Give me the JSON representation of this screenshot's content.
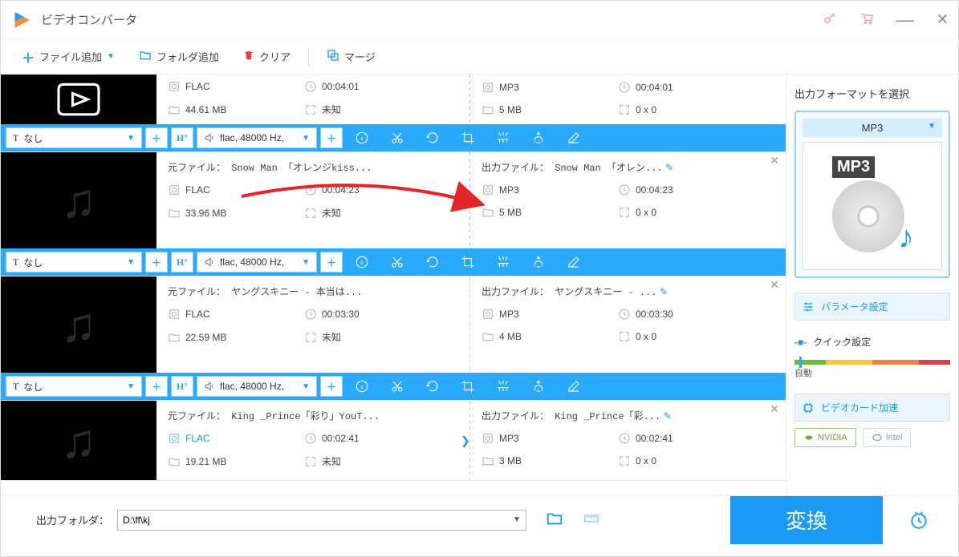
{
  "app": {
    "title": "ビデオコンバータ"
  },
  "toolbar": {
    "add_file": "ファイル追加",
    "add_folder": "フォルダ追加",
    "clear": "クリア",
    "merge": "マージ"
  },
  "controls": {
    "subtitle_none": "なし",
    "audio_fmt": "flac, 48000 Hz,"
  },
  "files": [
    {
      "src_name": "",
      "out_name": "",
      "src_codec": "FLAC",
      "src_dur": "00:04:01",
      "src_size": "44.61 MB",
      "src_res": "未知",
      "out_codec": "MP3",
      "out_dur": "00:04:01",
      "out_size": "5 MB",
      "out_res": "0 x 0"
    },
    {
      "src_name": "元ファイル： Snow Man 「オレンジkiss...",
      "out_name": "出力ファイル： Snow Man 「オレン...",
      "src_codec": "FLAC",
      "src_dur": "00:04:23",
      "src_size": "33.96 MB",
      "src_res": "未知",
      "out_codec": "MP3",
      "out_dur": "00:04:23",
      "out_size": "5 MB",
      "out_res": "0 x 0"
    },
    {
      "src_name": "元ファイル： ヤングスキニー - 本当は...",
      "out_name": "出力ファイル： ヤングスキニー - ...",
      "src_codec": "FLAC",
      "src_dur": "00:03:30",
      "src_size": "22.59 MB",
      "src_res": "未知",
      "out_codec": "MP3",
      "out_dur": "00:03:30",
      "out_size": "4 MB",
      "out_res": "0 x 0"
    },
    {
      "src_name": "元ファイル： King _Prince「彩り」YouT...",
      "out_name": "出力ファイル： King _Prince「彩...",
      "src_codec": "FLAC",
      "src_dur": "00:02:41",
      "src_size": "19.21 MB",
      "src_res": "未知",
      "out_codec": "MP3",
      "out_dur": "00:02:41",
      "out_size": "3 MB",
      "out_res": "0 x 0"
    }
  ],
  "sidebar": {
    "title": "出力フォーマットを選択",
    "format": "MP3",
    "format_big": "MP3",
    "param_settings": "パラメータ設定",
    "quick_settings": "クイック設定",
    "slider_label": "自動",
    "gpu_accel": "ビデオカード加速",
    "nvidia": "NVIDIA",
    "intel": "Intel"
  },
  "footer": {
    "label": "出力フォルダ：",
    "path": "D:\\ff\\kj",
    "convert": "変換"
  }
}
